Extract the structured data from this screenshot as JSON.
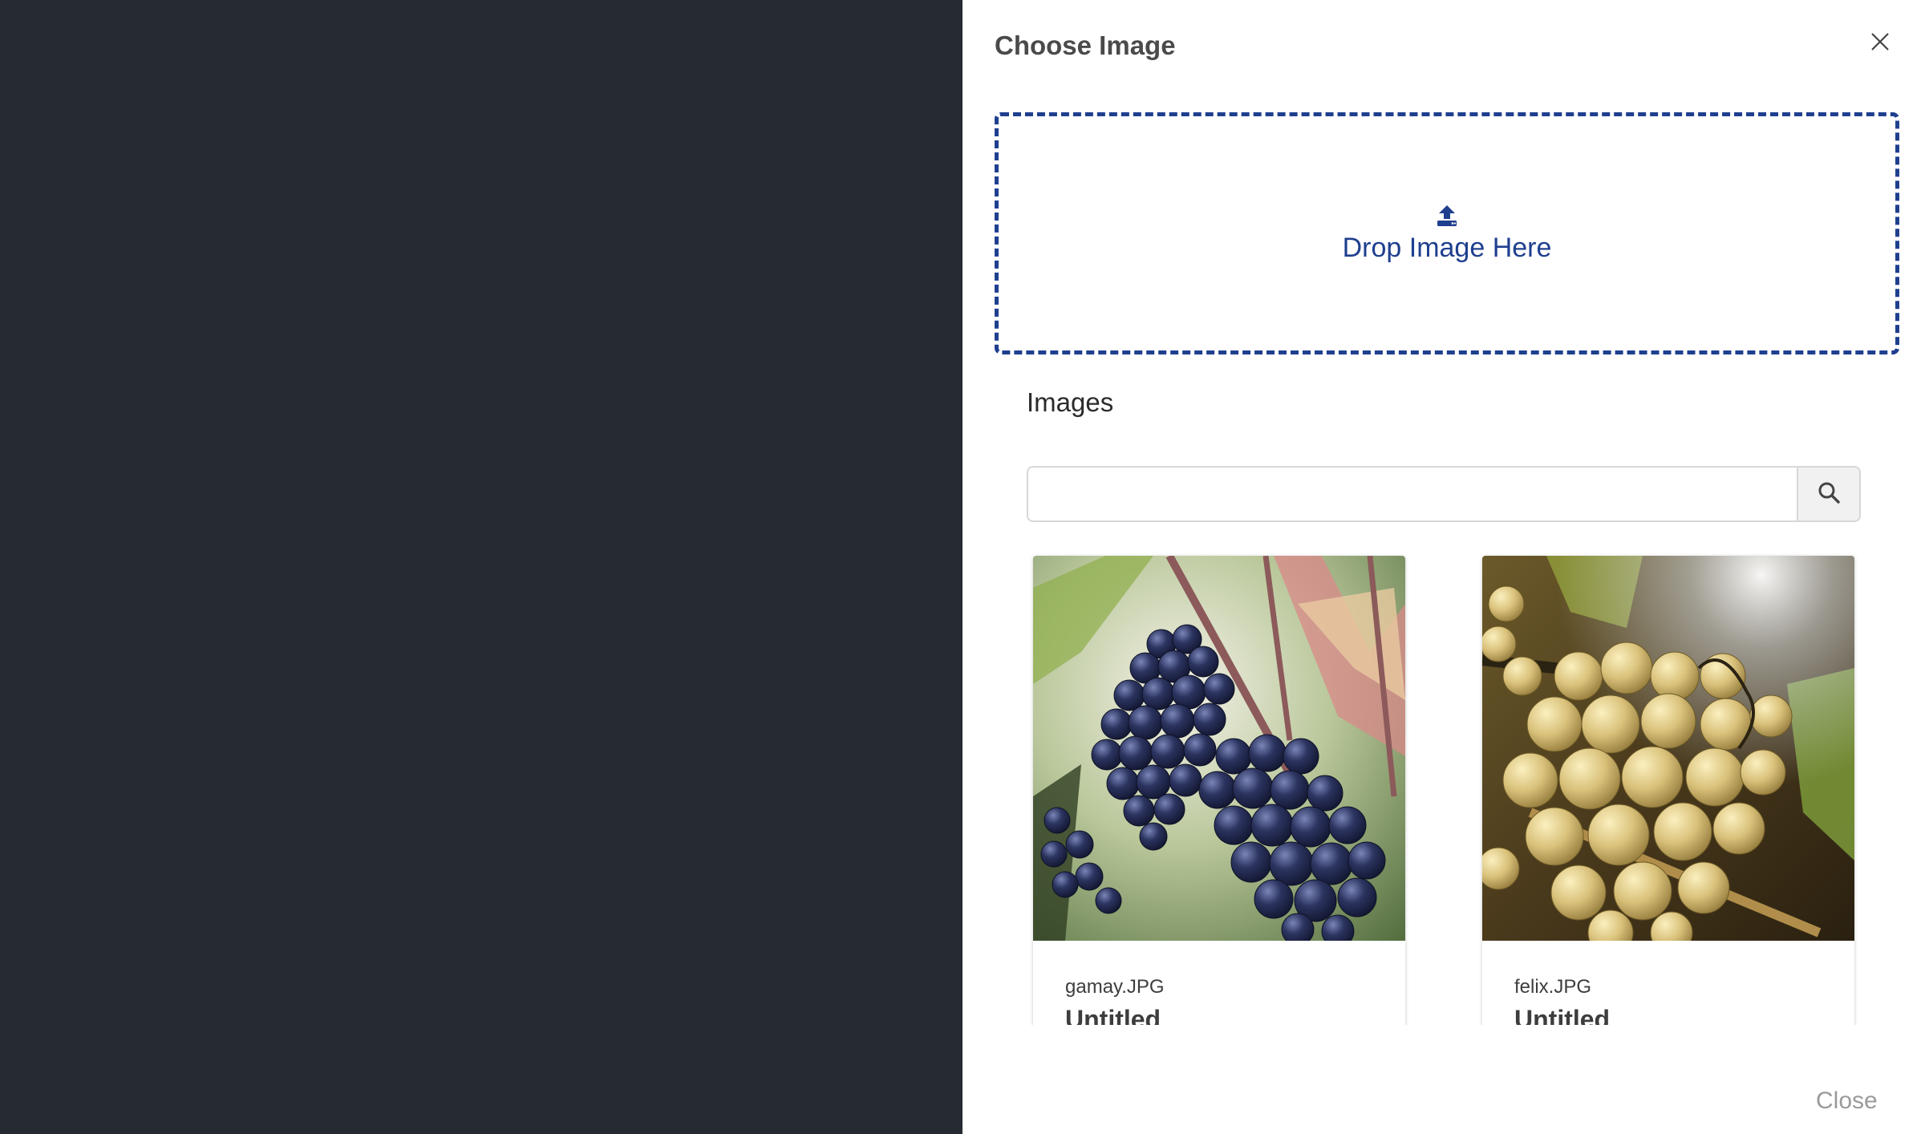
{
  "panel": {
    "title": "Choose Image",
    "close_icon": "close-icon"
  },
  "dropzone": {
    "icon": "upload-icon",
    "label": "Drop Image Here",
    "accent_color": "#1f3f8f"
  },
  "images": {
    "heading": "Images",
    "search": {
      "value": "",
      "placeholder": "",
      "icon": "search-icon"
    },
    "cards": [
      {
        "filename": "gamay.JPG",
        "title": "Untitled",
        "image": "dark purple grape cluster on vine"
      },
      {
        "filename": "felix.JPG",
        "title": "Untitled",
        "image": "golden white grape cluster in sunlight"
      }
    ]
  },
  "footer": {
    "close_label": "Close"
  },
  "colors": {
    "backdrop": "#262a33",
    "panel": "#ffffff",
    "title_text": "#4a4a4a"
  }
}
